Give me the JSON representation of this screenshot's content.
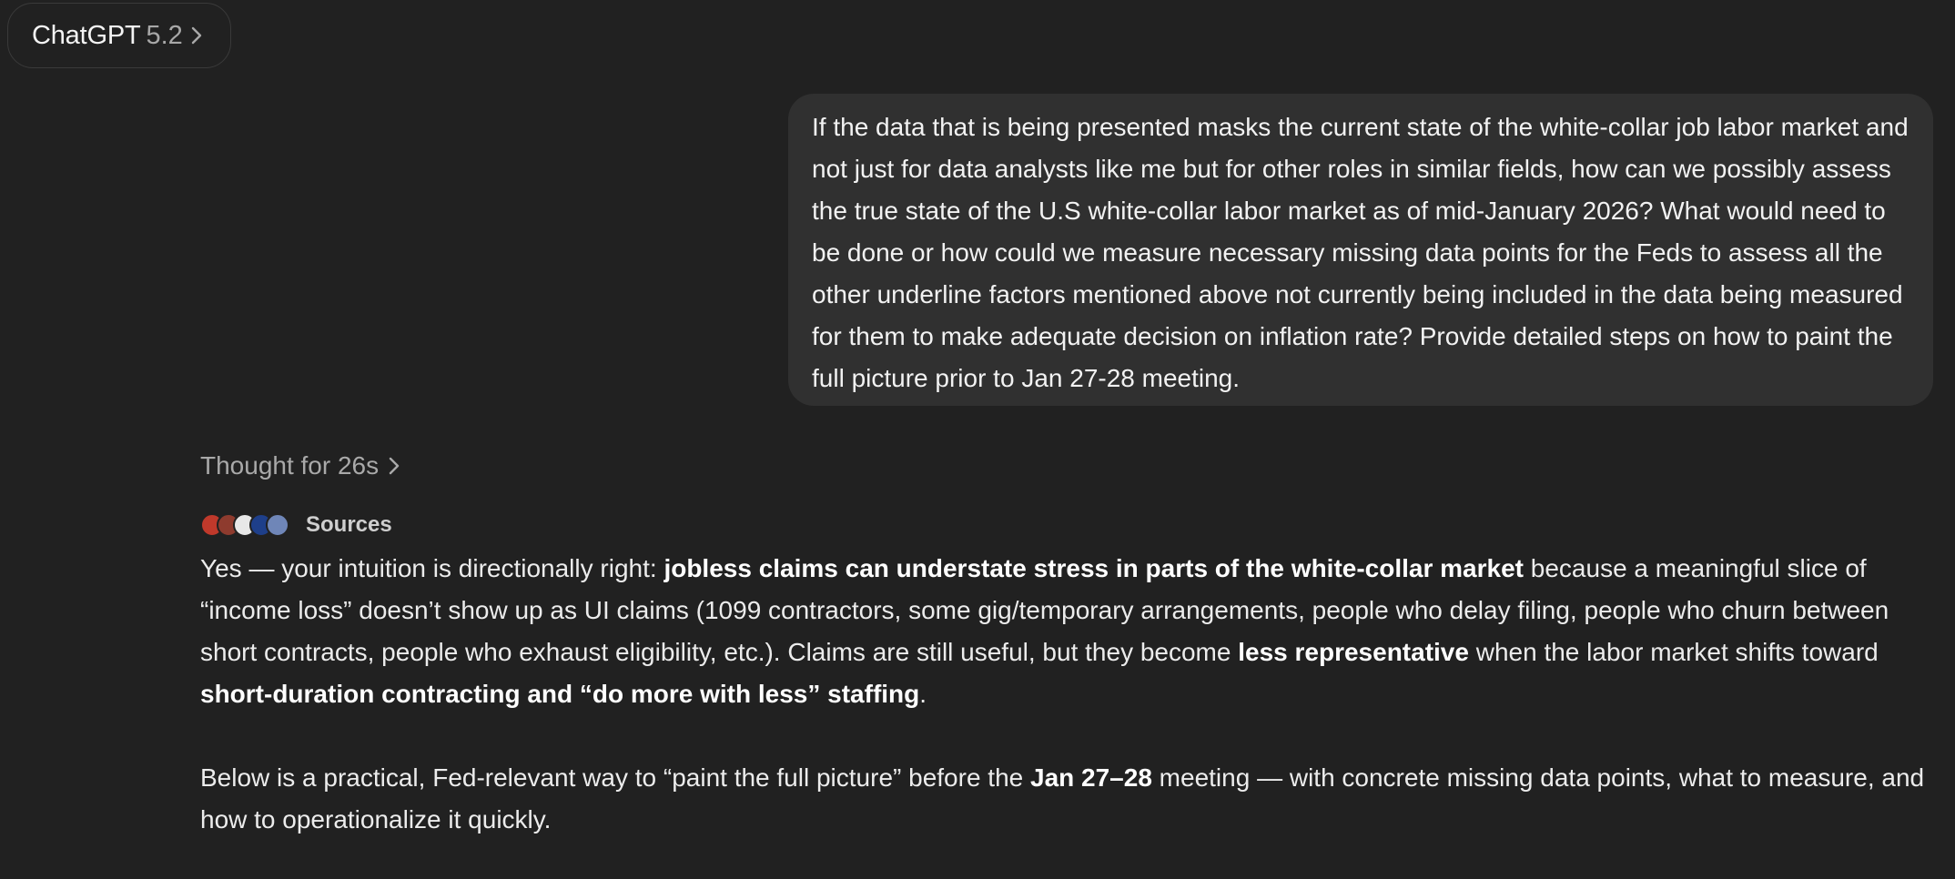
{
  "header": {
    "model_name": "ChatGPT",
    "model_version": "5.2"
  },
  "user_message": {
    "text": "If the data that is being presented masks the current state of the white-collar job labor market and not just for data analysts like me but for other roles in similar fields, how can we possibly assess the true state of the U.S white-collar labor market as of mid-January 2026? What would need to be done or how could we measure necessary missing data points for the Feds to assess all the other underline factors mentioned above not currently being included in the data being measured for them to make adequate decision on inflation rate? Provide detailed steps on how to paint the full picture prior to Jan 27-28 meeting."
  },
  "assistant": {
    "thought_label": "Thought for 26s",
    "sources_label": "Sources",
    "source_icons": [
      {
        "name": "source-favicon-1",
        "color": "#c0392b"
      },
      {
        "name": "source-favicon-2",
        "color": "#8e3b2e"
      },
      {
        "name": "source-favicon-3",
        "color": "#e8e8e8"
      },
      {
        "name": "source-favicon-4",
        "color": "#1e3f8a"
      },
      {
        "name": "source-favicon-5",
        "color": "#6f86b8"
      }
    ],
    "paragraph1": {
      "t1": "Yes — your intuition is directionally right: ",
      "b1": "jobless claims can understate stress in parts of the white-collar market",
      "t2": " because a meaningful slice of “income loss” doesn’t show up as UI claims (1099 contractors, some gig/temporary arrangements, people who delay filing, people who churn between short contracts, people who exhaust eligibility, etc.). Claims are still useful, but they become ",
      "b2": "less representative",
      "t3": " when the labor market shifts toward ",
      "b3": "short-duration contracting and “do more with less” staffing",
      "t4": "."
    },
    "paragraph2": {
      "t1": "Below is a practical, Fed-relevant way to “paint the full picture” before the ",
      "b1": "Jan 27–28",
      "t2": " meeting — with concrete missing data points, what to measure, and how to operationalize it quickly."
    }
  },
  "colors": {
    "background": "#212121",
    "user_bubble": "#303030",
    "text_primary": "#ececec",
    "text_muted": "#a9a9a9"
  }
}
